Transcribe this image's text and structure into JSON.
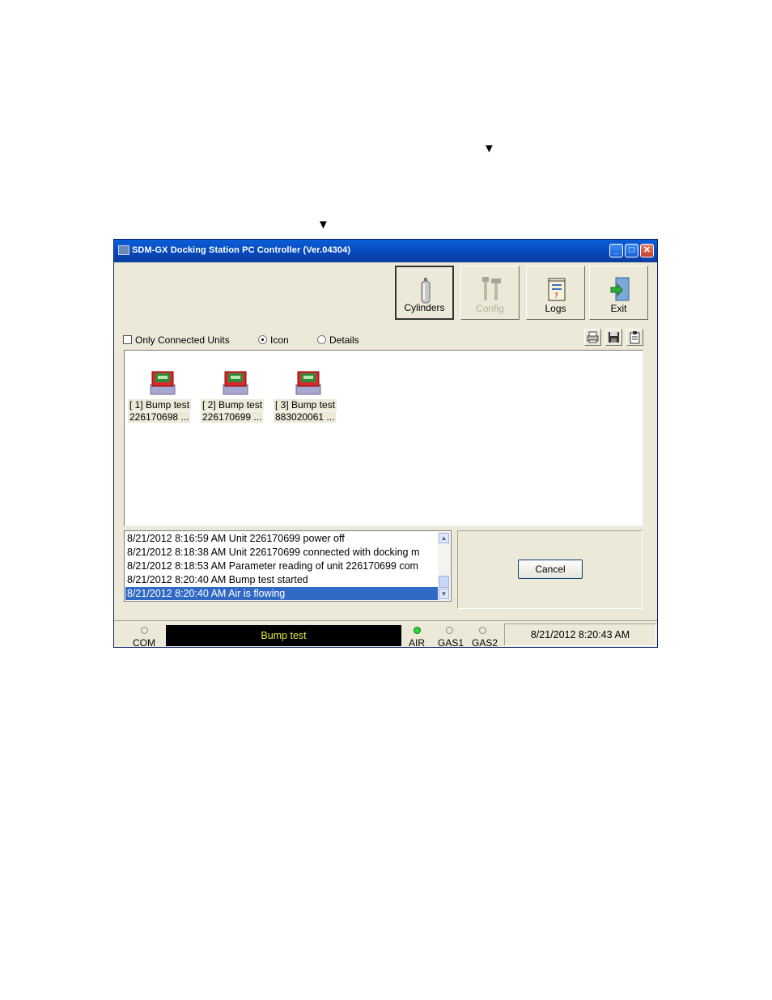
{
  "window": {
    "title": "SDM-GX Docking Station PC Controller (Ver.04304)",
    "controls": {
      "minimize": "_",
      "maximize": "□",
      "close": "✕"
    }
  },
  "toolbar": {
    "cylinders_label": "Cylinders",
    "config_label": "Config",
    "logs_label": "Logs",
    "exit_label": "Exit"
  },
  "view_options": {
    "only_connected_label": "Only Connected Units",
    "only_connected_checked": false,
    "icon_label": "Icon",
    "details_label": "Details",
    "selected_view": "Icon"
  },
  "units": [
    {
      "line1": "[ 1] Bump test",
      "line2": "226170698   ..."
    },
    {
      "line1": "[ 2] Bump test",
      "line2": "226170699   ..."
    },
    {
      "line1": "[ 3] Bump test",
      "line2": "883020061   ..."
    }
  ],
  "log": [
    "8/21/2012 8:16:59 AM Unit 226170699 power off",
    "8/21/2012 8:18:38 AM Unit 226170699 connected with docking m",
    "8/21/2012 8:18:53 AM Parameter reading of unit 226170699 com",
    "8/21/2012 8:20:40 AM Bump test started",
    "8/21/2012 8:20:40 AM Air is flowing"
  ],
  "log_selected_index": 4,
  "action": {
    "cancel_label": "Cancel"
  },
  "status": {
    "com_label": "COM",
    "display_text": "Bump test",
    "air_label": "AIR",
    "gas1_label": "GAS1",
    "gas2_label": "GAS2",
    "air_on": true,
    "datetime": "8/21/2012 8:20:43 AM"
  },
  "markers": {
    "arrow_1": "▼",
    "arrow_2": "▼"
  },
  "colors": {
    "title_bar": "#0646b8",
    "selection": "#316ac5",
    "led_on": "#2fd33a",
    "status_text": "#e9e940"
  }
}
